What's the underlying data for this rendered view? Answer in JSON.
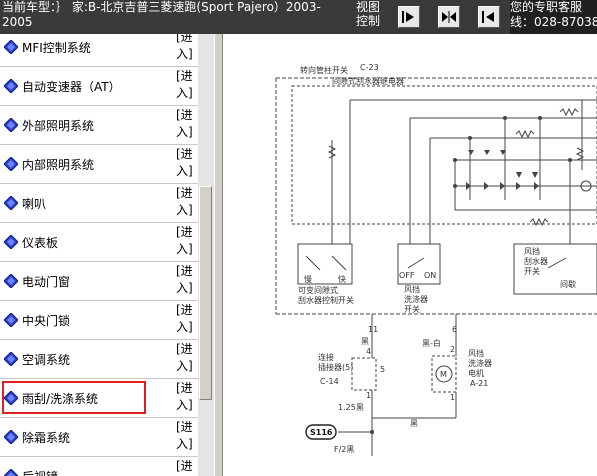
{
  "topbar": {
    "vehicle_text": "当前车型：｝ 家:B-北京吉普三菱速跑(Sport Pajero）2003-\n2005",
    "view_control": "视图\n控制",
    "service_text": "您的专职客服\n线：028-87038"
  },
  "toolbar": {
    "buttons": [
      {
        "icon": "collapse-left-icon"
      },
      {
        "icon": "expand-both-icon"
      },
      {
        "icon": "expand-right-icon"
      }
    ]
  },
  "sidebar": {
    "enter_label": "[进\n入]",
    "selected_index": 9,
    "items": [
      {
        "label": "MFI控制系统"
      },
      {
        "label": "自动变速器（AT）"
      },
      {
        "label": "外部照明系统"
      },
      {
        "label": "内部照明系统"
      },
      {
        "label": "喇叭"
      },
      {
        "label": "仪表板"
      },
      {
        "label": "电动门窗"
      },
      {
        "label": "中央门锁"
      },
      {
        "label": "空调系统"
      },
      {
        "label": "雨刮/洗涤系统"
      },
      {
        "label": "除霜系统"
      },
      {
        "label": "后视镜"
      }
    ]
  },
  "diagram": {
    "labels": {
      "column_switch": "转向管柱开关",
      "column_ref": "C-23",
      "intermittent_relay": "间隙式刮水器继电器",
      "variable_switch": "可变间隙式\n刮水器控制开关",
      "slow": "慢",
      "fast": "快",
      "off": "OFF",
      "on": "ON",
      "intermittent": "间歇",
      "washer_switch": "风挡\n洗涤器\n开关",
      "wiper_switch": "风挡\n刮水器\n开关",
      "wire_11": "11",
      "wire_6": "6",
      "black": "黑",
      "black_white": "黑-白",
      "conn_label": "连接\n插接器(5)",
      "conn_ref": "C-14",
      "pin_4": "4",
      "pin_5": "5",
      "pin_1a": "1",
      "pin_2": "2",
      "pin_1b": "1",
      "washer_motor": "风挡\n洗涤器\n电机",
      "motor_ref": "A-21",
      "motor_m": "M",
      "gauge": "1.25黑",
      "ground": "S116",
      "ground_ref": "F/2黑",
      "black2": "黑"
    }
  }
}
